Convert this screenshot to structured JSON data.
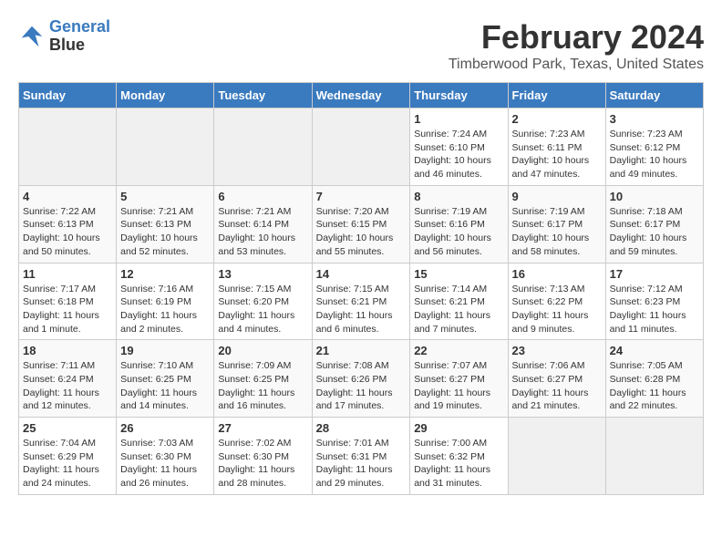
{
  "logo": {
    "line1": "General",
    "line2": "Blue"
  },
  "title": "February 2024",
  "location": "Timberwood Park, Texas, United States",
  "days_of_week": [
    "Sunday",
    "Monday",
    "Tuesday",
    "Wednesday",
    "Thursday",
    "Friday",
    "Saturday"
  ],
  "weeks": [
    [
      {
        "day": "",
        "info": ""
      },
      {
        "day": "",
        "info": ""
      },
      {
        "day": "",
        "info": ""
      },
      {
        "day": "",
        "info": ""
      },
      {
        "day": "1",
        "info": "Sunrise: 7:24 AM\nSunset: 6:10 PM\nDaylight: 10 hours\nand 46 minutes."
      },
      {
        "day": "2",
        "info": "Sunrise: 7:23 AM\nSunset: 6:11 PM\nDaylight: 10 hours\nand 47 minutes."
      },
      {
        "day": "3",
        "info": "Sunrise: 7:23 AM\nSunset: 6:12 PM\nDaylight: 10 hours\nand 49 minutes."
      }
    ],
    [
      {
        "day": "4",
        "info": "Sunrise: 7:22 AM\nSunset: 6:13 PM\nDaylight: 10 hours\nand 50 minutes."
      },
      {
        "day": "5",
        "info": "Sunrise: 7:21 AM\nSunset: 6:13 PM\nDaylight: 10 hours\nand 52 minutes."
      },
      {
        "day": "6",
        "info": "Sunrise: 7:21 AM\nSunset: 6:14 PM\nDaylight: 10 hours\nand 53 minutes."
      },
      {
        "day": "7",
        "info": "Sunrise: 7:20 AM\nSunset: 6:15 PM\nDaylight: 10 hours\nand 55 minutes."
      },
      {
        "day": "8",
        "info": "Sunrise: 7:19 AM\nSunset: 6:16 PM\nDaylight: 10 hours\nand 56 minutes."
      },
      {
        "day": "9",
        "info": "Sunrise: 7:19 AM\nSunset: 6:17 PM\nDaylight: 10 hours\nand 58 minutes."
      },
      {
        "day": "10",
        "info": "Sunrise: 7:18 AM\nSunset: 6:17 PM\nDaylight: 10 hours\nand 59 minutes."
      }
    ],
    [
      {
        "day": "11",
        "info": "Sunrise: 7:17 AM\nSunset: 6:18 PM\nDaylight: 11 hours\nand 1 minute."
      },
      {
        "day": "12",
        "info": "Sunrise: 7:16 AM\nSunset: 6:19 PM\nDaylight: 11 hours\nand 2 minutes."
      },
      {
        "day": "13",
        "info": "Sunrise: 7:15 AM\nSunset: 6:20 PM\nDaylight: 11 hours\nand 4 minutes."
      },
      {
        "day": "14",
        "info": "Sunrise: 7:15 AM\nSunset: 6:21 PM\nDaylight: 11 hours\nand 6 minutes."
      },
      {
        "day": "15",
        "info": "Sunrise: 7:14 AM\nSunset: 6:21 PM\nDaylight: 11 hours\nand 7 minutes."
      },
      {
        "day": "16",
        "info": "Sunrise: 7:13 AM\nSunset: 6:22 PM\nDaylight: 11 hours\nand 9 minutes."
      },
      {
        "day": "17",
        "info": "Sunrise: 7:12 AM\nSunset: 6:23 PM\nDaylight: 11 hours\nand 11 minutes."
      }
    ],
    [
      {
        "day": "18",
        "info": "Sunrise: 7:11 AM\nSunset: 6:24 PM\nDaylight: 11 hours\nand 12 minutes."
      },
      {
        "day": "19",
        "info": "Sunrise: 7:10 AM\nSunset: 6:25 PM\nDaylight: 11 hours\nand 14 minutes."
      },
      {
        "day": "20",
        "info": "Sunrise: 7:09 AM\nSunset: 6:25 PM\nDaylight: 11 hours\nand 16 minutes."
      },
      {
        "day": "21",
        "info": "Sunrise: 7:08 AM\nSunset: 6:26 PM\nDaylight: 11 hours\nand 17 minutes."
      },
      {
        "day": "22",
        "info": "Sunrise: 7:07 AM\nSunset: 6:27 PM\nDaylight: 11 hours\nand 19 minutes."
      },
      {
        "day": "23",
        "info": "Sunrise: 7:06 AM\nSunset: 6:27 PM\nDaylight: 11 hours\nand 21 minutes."
      },
      {
        "day": "24",
        "info": "Sunrise: 7:05 AM\nSunset: 6:28 PM\nDaylight: 11 hours\nand 22 minutes."
      }
    ],
    [
      {
        "day": "25",
        "info": "Sunrise: 7:04 AM\nSunset: 6:29 PM\nDaylight: 11 hours\nand 24 minutes."
      },
      {
        "day": "26",
        "info": "Sunrise: 7:03 AM\nSunset: 6:30 PM\nDaylight: 11 hours\nand 26 minutes."
      },
      {
        "day": "27",
        "info": "Sunrise: 7:02 AM\nSunset: 6:30 PM\nDaylight: 11 hours\nand 28 minutes."
      },
      {
        "day": "28",
        "info": "Sunrise: 7:01 AM\nSunset: 6:31 PM\nDaylight: 11 hours\nand 29 minutes."
      },
      {
        "day": "29",
        "info": "Sunrise: 7:00 AM\nSunset: 6:32 PM\nDaylight: 11 hours\nand 31 minutes."
      },
      {
        "day": "",
        "info": ""
      },
      {
        "day": "",
        "info": ""
      }
    ]
  ]
}
